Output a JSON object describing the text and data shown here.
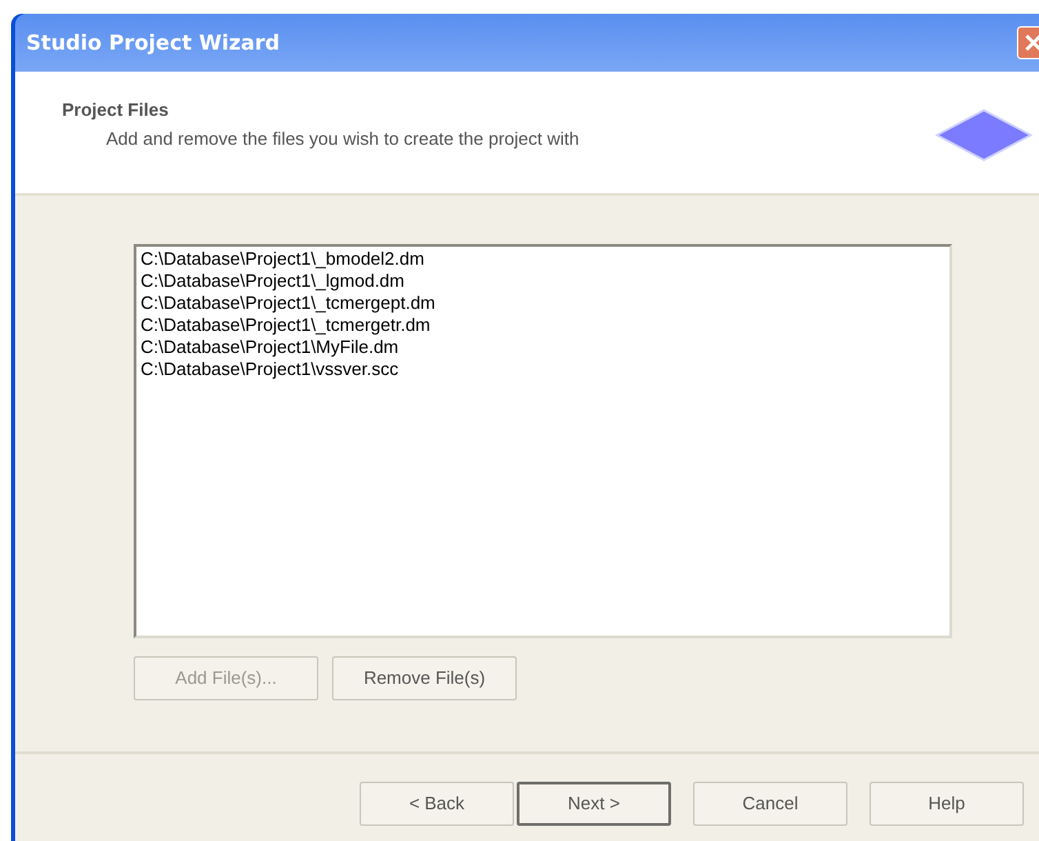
{
  "window": {
    "title": "Studio Project Wizard"
  },
  "header": {
    "title": "Project Files",
    "subtitle": "Add and remove the files you wish to create the project with"
  },
  "files": [
    {
      "path": "C:\\Database\\Project1\\_bmodel2.dm"
    },
    {
      "path": "C:\\Database\\Project1\\_lgmod.dm"
    },
    {
      "path": "C:\\Database\\Project1\\_tcmergept.dm"
    },
    {
      "path": "C:\\Database\\Project1\\_tcmergetr.dm"
    },
    {
      "path": "C:\\Database\\Project1\\MyFile.dm"
    },
    {
      "path": "C:\\Database\\Project1\\vssver.scc"
    }
  ],
  "file_buttons": [
    {
      "label": "Add File(s)...",
      "disabled": true
    },
    {
      "label": "Remove File(s)",
      "disabled": false
    }
  ],
  "nav_buttons": [
    {
      "label": "< Back",
      "default": false
    },
    {
      "label": "Next >",
      "default": true
    },
    {
      "label": "Cancel",
      "default": false
    },
    {
      "label": "Help",
      "default": false
    }
  ]
}
